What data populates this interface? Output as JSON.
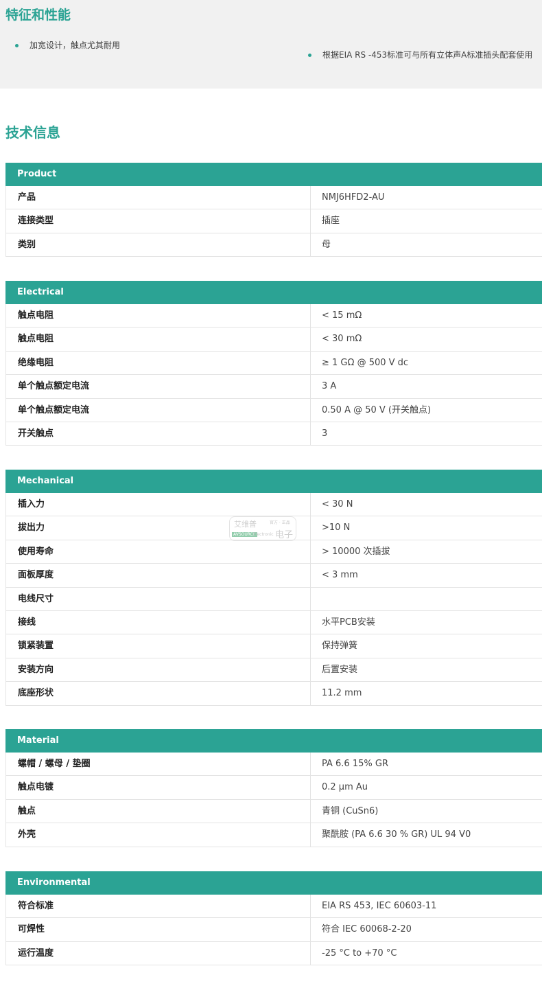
{
  "features": {
    "title": "特征和性能",
    "items": [
      "加宽设计，触点尤其耐用",
      "根据EIA RS -453标准可与所有立体声A标准插头配套使用"
    ]
  },
  "tech": {
    "title": "技术信息"
  },
  "sections": [
    {
      "name": "Product",
      "rows": [
        [
          "产品",
          "NMJ6HFD2-AU"
        ],
        [
          "连接类型",
          "插座"
        ],
        [
          "类别",
          "母"
        ]
      ]
    },
    {
      "name": "Electrical",
      "rows": [
        [
          "触点电阻",
          "< 15 mΩ"
        ],
        [
          "触点电阻",
          "< 30 mΩ"
        ],
        [
          "绝缘电阻",
          "≥ 1 GΩ @ 500 V dc"
        ],
        [
          "单个触点额定电流",
          "3 A"
        ],
        [
          "单个触点额定电流",
          "0.50 A @ 50 V (开关触点)"
        ],
        [
          "开关触点",
          "3"
        ]
      ]
    },
    {
      "name": "Mechanical",
      "rows": [
        [
          "插入力",
          "< 30 N"
        ],
        [
          "拔出力",
          ">10 N"
        ],
        [
          "使用寿命",
          "> 10000 次插拔"
        ],
        [
          "面板厚度",
          "< 3 mm"
        ],
        [
          "电线尺寸",
          ""
        ],
        [
          "接线",
          "水平PCB安装"
        ],
        [
          "锁紧装置",
          "保持弹簧"
        ],
        [
          "安装方向",
          "后置安装"
        ],
        [
          "底座形状",
          "11.2 mm"
        ]
      ]
    },
    {
      "name": "Material",
      "rows": [
        [
          "螺帽 / 螺母 / 垫圈",
          "PA 6.6 15% GR"
        ],
        [
          "触点电镀",
          "0.2 µm Au"
        ],
        [
          "触点",
          "青铜 (CuSn6)"
        ],
        [
          "外壳",
          "聚酰胺 (PA 6.6 30 % GR) UL 94 V0"
        ]
      ]
    },
    {
      "name": "Environmental",
      "rows": [
        [
          "符合标准",
          "EIA RS 453, IEC 60603-11"
        ],
        [
          "可焊性",
          "符合 IEC 60068-2-20"
        ],
        [
          "运行温度",
          "-25 °C to +70 °C"
        ]
      ]
    }
  ],
  "watermark": {
    "line1": "艾维普",
    "line2": "官方 · 正品",
    "line3": "AVSOURCE",
    "line4": "Electronic",
    "line5": "电子"
  }
}
